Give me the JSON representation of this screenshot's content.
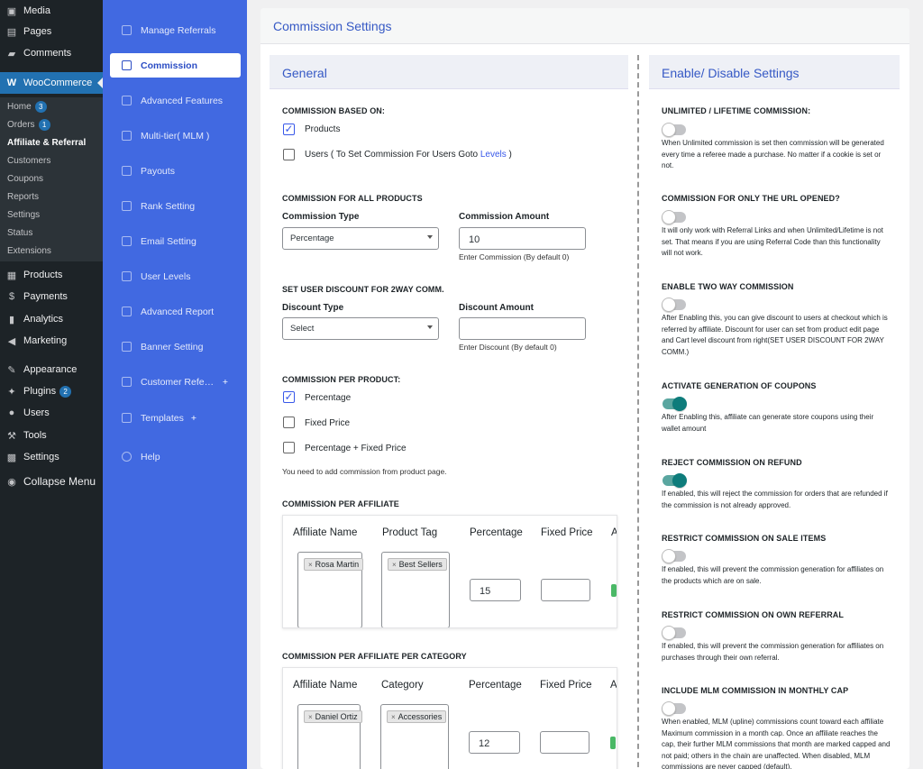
{
  "wp_menu": {
    "top": [
      {
        "label": "Media",
        "icon": "media-icon"
      },
      {
        "label": "Pages",
        "icon": "pages-icon"
      },
      {
        "label": "Comments",
        "icon": "comments-icon"
      }
    ],
    "woocommerce": "WooCommerce",
    "wc_sub": [
      {
        "label": "Home",
        "badge": "3"
      },
      {
        "label": "Orders",
        "badge": "1"
      },
      {
        "label": "Affiliate & Referral",
        "badge": ""
      },
      {
        "label": "Customers",
        "badge": ""
      },
      {
        "label": "Coupons",
        "badge": ""
      },
      {
        "label": "Reports",
        "badge": ""
      },
      {
        "label": "Settings",
        "badge": ""
      },
      {
        "label": "Status",
        "badge": ""
      },
      {
        "label": "Extensions",
        "badge": ""
      }
    ],
    "bottom": [
      {
        "label": "Products",
        "icon": "products-icon",
        "badge": ""
      },
      {
        "label": "Payments",
        "icon": "payments-icon",
        "badge": ""
      },
      {
        "label": "Analytics",
        "icon": "analytics-icon",
        "badge": ""
      },
      {
        "label": "Marketing",
        "icon": "marketing-icon",
        "badge": ""
      },
      {
        "label": "Appearance",
        "icon": "appearance-icon",
        "badge": ""
      },
      {
        "label": "Plugins",
        "icon": "plugins-icon",
        "badge": "2"
      },
      {
        "label": "Users",
        "icon": "users-icon",
        "badge": ""
      },
      {
        "label": "Tools",
        "icon": "tools-icon",
        "badge": ""
      },
      {
        "label": "Settings",
        "icon": "settings-icon",
        "badge": ""
      },
      {
        "label": "Collapse Menu",
        "icon": "collapse-icon",
        "badge": ""
      }
    ]
  },
  "plugin_nav": [
    "Manage Referrals",
    "Commission",
    "Advanced Features",
    "Multi-tier( MLM )",
    "Payouts",
    "Rank Setting",
    "Email Setting",
    "User Levels",
    "Advanced Report",
    "Banner Setting",
    "Customer Refe…",
    "Templates",
    "Help"
  ],
  "page_title": "Commission Settings",
  "general": {
    "title": "General",
    "based_on": "COMMISSION BASED ON:",
    "opt_products": "Products",
    "opt_users": "Users ( To Set Commission For Users Goto ",
    "opt_users_link": "Levels",
    "opt_users_end": " )",
    "all_products": "COMMISSION FOR ALL PRODUCTS",
    "commission_type_label": "Commission Type",
    "commission_type_value": "Percentage",
    "commission_amount_label": "Commission Amount",
    "commission_amount_value": "10",
    "commission_amount_hint": "Enter Commission (By default 0)",
    "discount_section": "SET USER DISCOUNT FOR 2WAY COMM.",
    "discount_type_label": "Discount Type",
    "discount_type_value": "Select",
    "discount_amount_label": "Discount Amount",
    "discount_amount_hint": "Enter Discount (By default 0)",
    "per_product": "COMMISSION PER PRODUCT:",
    "pp_opts": [
      "Percentage",
      "Fixed Price",
      "Percentage + Fixed Price"
    ],
    "pp_note": "You need to add commission from product page.",
    "per_affiliate": "COMMISSION PER AFFILIATE",
    "t1_headers": [
      "Affiliate Name",
      "Product Tag",
      "Percentage",
      "Fixed Price",
      "A"
    ],
    "t1_affiliate": "Rosa Martin",
    "t1_tag": "Best Sellers",
    "t1_percentage": "15",
    "per_aff_cat": "COMMISSION PER AFFILIATE PER CATEGORY",
    "t2_headers": [
      "Affiliate Name",
      "Category",
      "Percentage",
      "Fixed Price",
      "A"
    ],
    "t2_affiliate": "Daniel Ortiz",
    "t2_category": "Accessories",
    "t2_percentage": "12",
    "tag_remove": "×"
  },
  "enable": {
    "title": "Enable/ Disable Settings",
    "items": [
      {
        "label": "UNLIMITED / LIFETIME COMMISSION:",
        "on": false,
        "desc": "When Unlimited commission is set then commission will be generated every time a referee made a purchase. No matter if a cookie is set or not."
      },
      {
        "label": "COMMISSION FOR ONLY THE URL OPENED?",
        "on": false,
        "desc": "It will only work with Referral Links and when Unlimited/Lifetime is not set. That means if you are using Referral Code than this functionality will not work."
      },
      {
        "label": "ENABLE TWO WAY COMMISSION",
        "on": false,
        "desc": "After Enabling this, you can give discount to users at checkout which is referred by affiliate. Discount for user can set from product edit page and Cart level discount from right(SET USER DISCOUNT FOR 2WAY COMM.)"
      },
      {
        "label": "ACTIVATE GENERATION OF COUPONS",
        "on": true,
        "desc": "After Enabling this, affiliate can generate store coupons using their wallet amount"
      },
      {
        "label": "REJECT COMMISSION ON REFUND",
        "on": true,
        "desc": "If enabled, this will reject the commission for orders that are refunded if the commission is not already approved."
      },
      {
        "label": "RESTRICT COMMISSION ON SALE ITEMS",
        "on": false,
        "desc": "If enabled, this will prevent the commission generation for affiliates on the products which are on sale."
      },
      {
        "label": "RESTRICT COMMISSION ON OWN REFERRAL",
        "on": false,
        "desc": "If enabled, this will prevent the commission generation for affiliates on purchases through their own referral."
      },
      {
        "label": "INCLUDE MLM COMMISSION IN MONTHLY CAP",
        "on": false,
        "desc": "When enabled, MLM (upline) commissions count toward each affiliate Maximum commission in a month cap. Once an affiliate reaches the cap, their further MLM commissions that month are marked capped and not paid; others in the chain are unaffected. When disabled, MLM commissions are never capped (default)."
      }
    ]
  }
}
